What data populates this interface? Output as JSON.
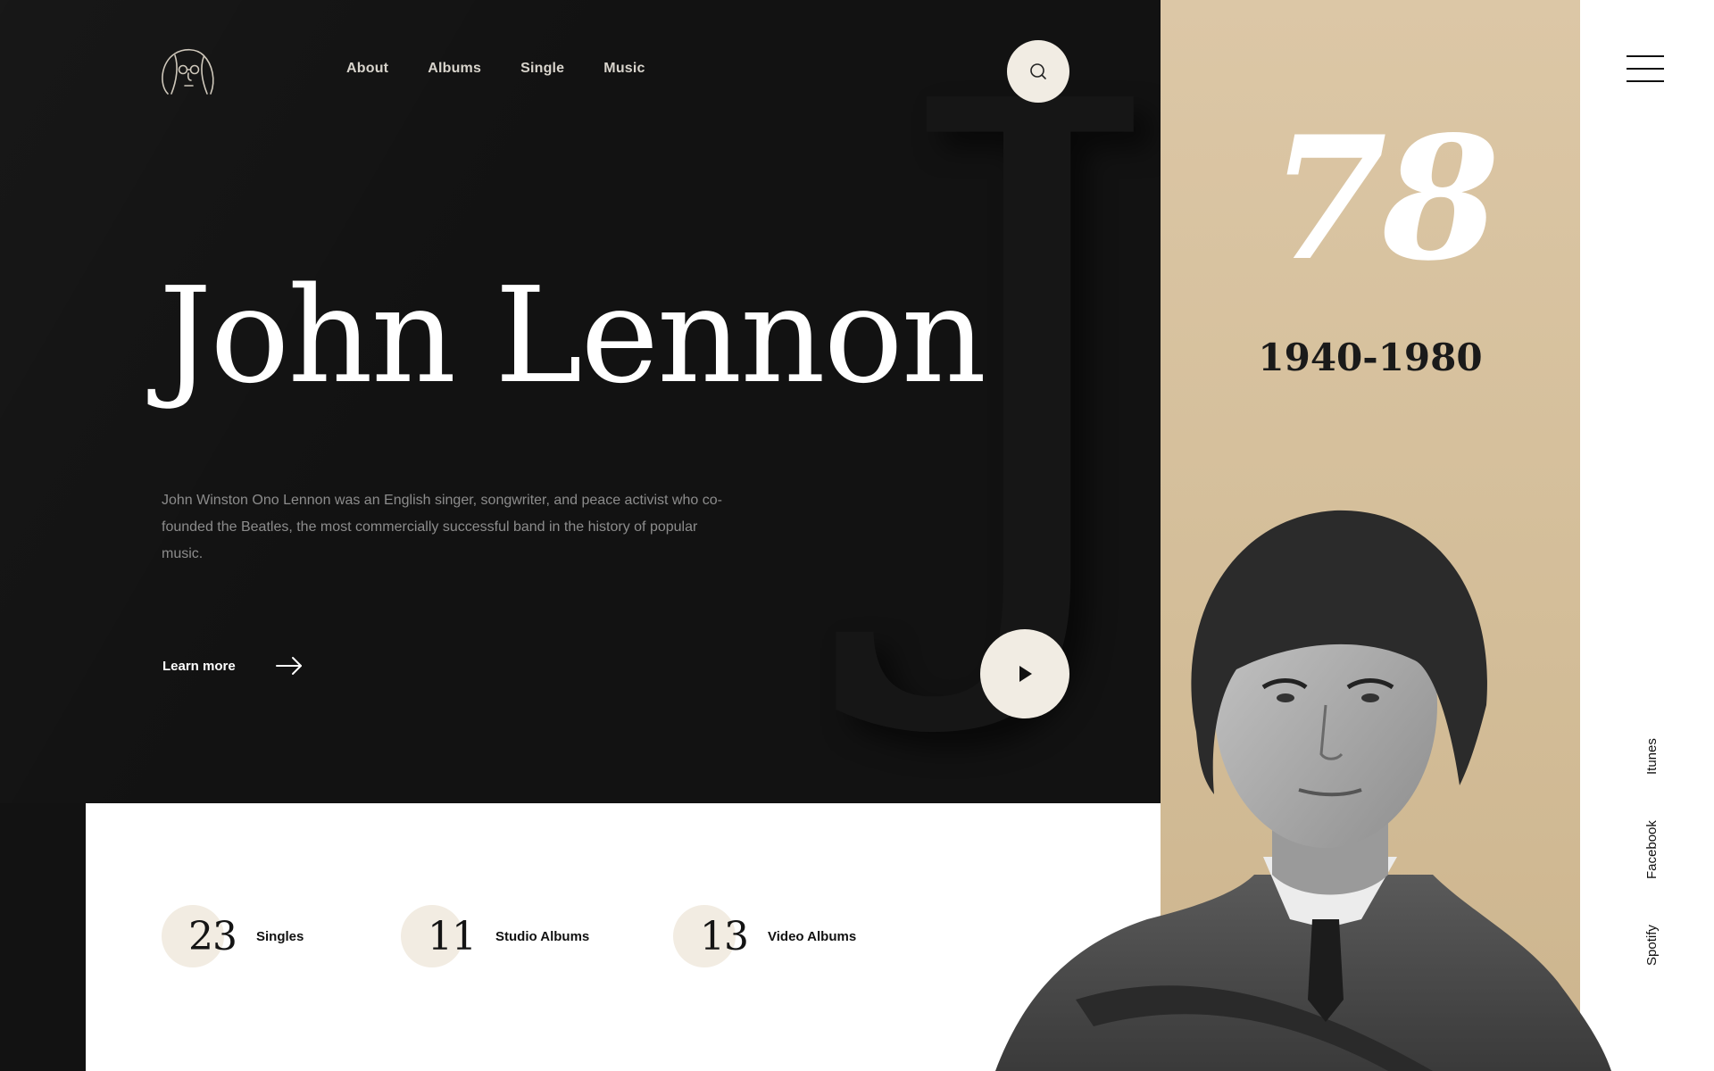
{
  "nav": {
    "items": [
      "About",
      "Albums",
      "Single",
      "Music"
    ]
  },
  "hero": {
    "title": "John Lennon",
    "description": "John Winston Ono Lennon was an English singer, songwriter, and peace activist who co-founded the Beatles, the most commercially successful band in the history of popular music.",
    "learn_more": "Learn more"
  },
  "side": {
    "age": "78",
    "years": "1940-1980"
  },
  "stats": [
    {
      "value": "23",
      "label": "Singles"
    },
    {
      "value": "11",
      "label": "Studio Albums"
    },
    {
      "value": "13",
      "label": "Video Albums"
    }
  ],
  "social": [
    "Itunes",
    "Facebook",
    "Spotify"
  ],
  "icons": {
    "logo": "lennon-portrait-logo",
    "search": "search-icon",
    "play": "play-icon",
    "arrow": "arrow-right-icon",
    "menu": "hamburger-menu-icon"
  },
  "colors": {
    "dark_bg": "#121212",
    "accent_tan": "#d8c39f",
    "cream": "#f1ece3"
  }
}
